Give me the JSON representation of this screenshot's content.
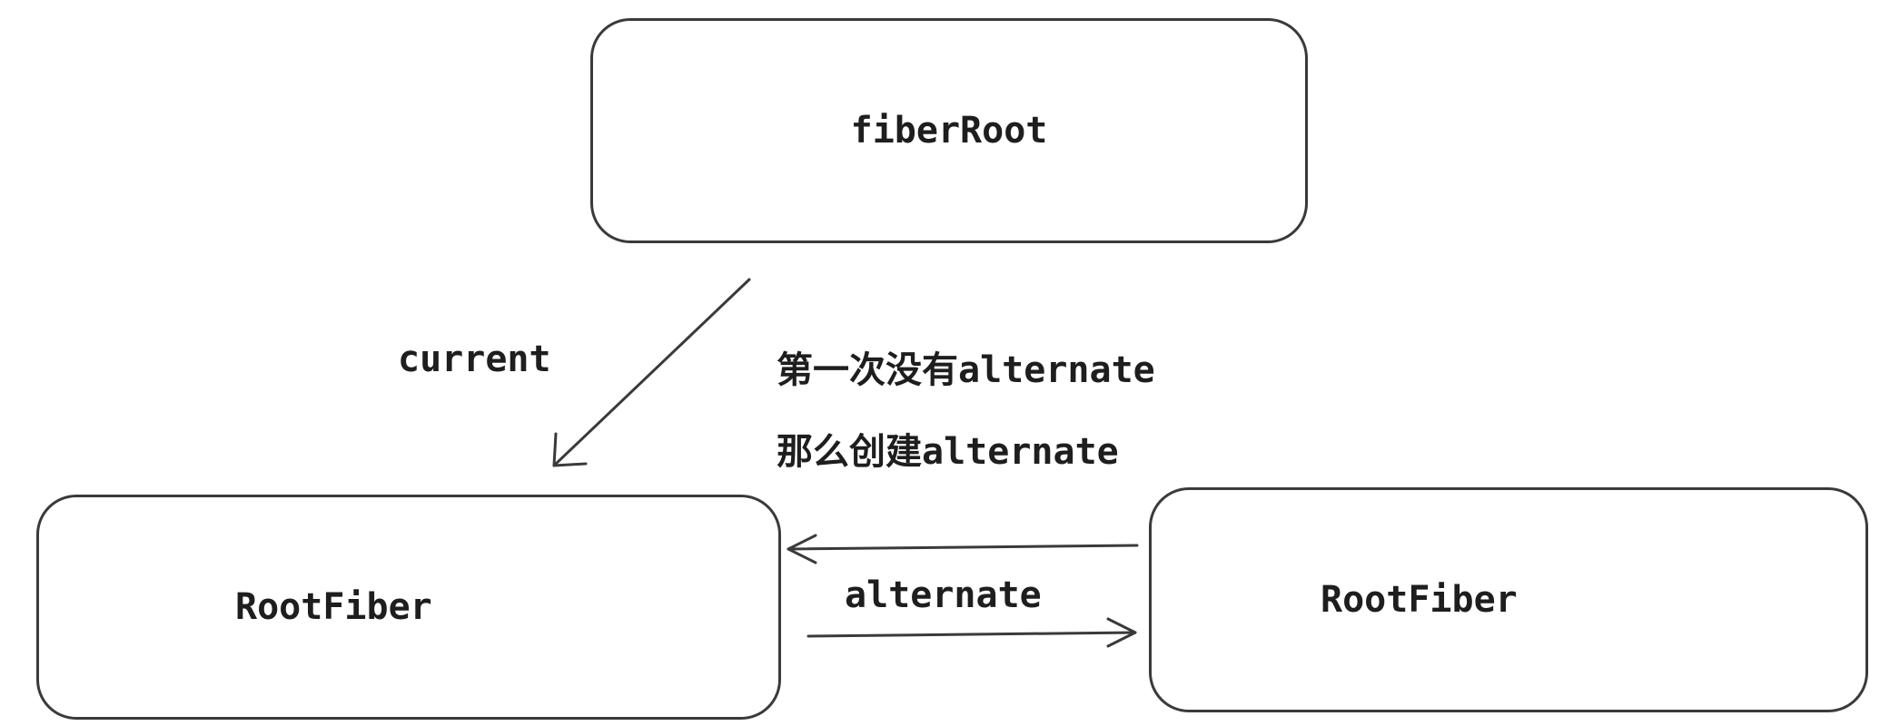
{
  "nodes": {
    "fiber_root": {
      "label": "fiberRoot"
    },
    "root_fiber_current": {
      "label": "RootFiber"
    },
    "root_fiber_alternate": {
      "label": "RootFiber"
    }
  },
  "edges": {
    "current": {
      "label": "current"
    },
    "alternate": {
      "label": "alternate"
    }
  },
  "notes": {
    "line1": "第一次没有alternate",
    "line2": "那么创建alternate"
  },
  "colors": {
    "stroke": "#3a3a3a",
    "text": "#1e1e1e",
    "background": "#ffffff"
  }
}
